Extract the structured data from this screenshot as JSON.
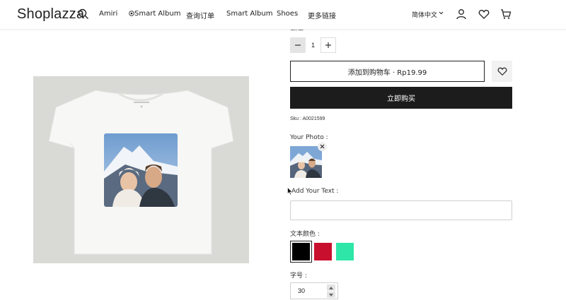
{
  "header": {
    "logo": "Shoplazza",
    "nav": [
      {
        "label": "Amiri"
      },
      {
        "label": "Smart Album"
      },
      {
        "label": "查询订单"
      },
      {
        "label": "Smart Album"
      },
      {
        "label": "Shoes"
      },
      {
        "label": "更多链接"
      }
    ],
    "language": "简体中文"
  },
  "product": {
    "quantity_label": "数量",
    "quantity": "1",
    "add_to_cart": "添加到购物车 · Rp19.99",
    "buy_now": "立即购买",
    "sku": "Sku : A0021599"
  },
  "customize": {
    "photo_label": "Your Photo :",
    "text_label": "Add Your Text :",
    "text_value": "",
    "color_label": "文本颜色 :",
    "colors": [
      "#000000",
      "#c8102e",
      "#2de6a7"
    ],
    "selected_color": "#000000",
    "size_label": "字号 :",
    "size_value": "30"
  }
}
